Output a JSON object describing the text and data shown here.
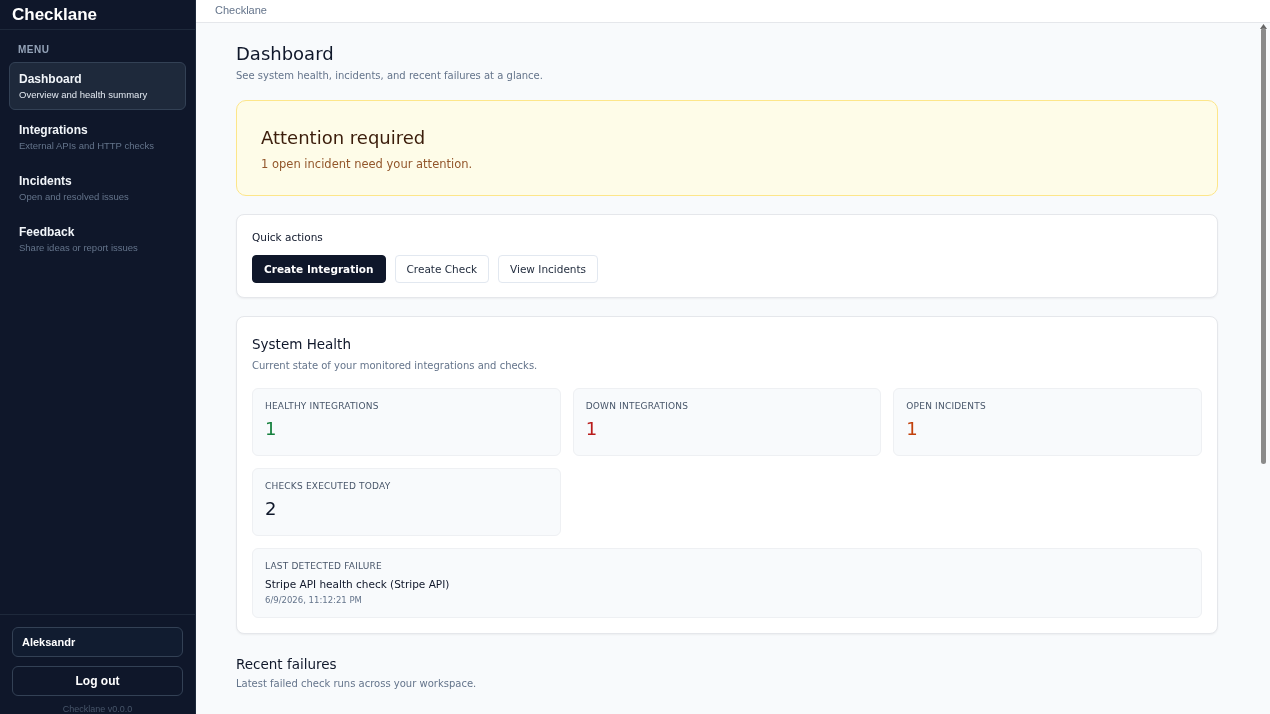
{
  "sidebar": {
    "brand": "Checklane",
    "section_label": "MENU",
    "items": [
      {
        "label": "Dashboard",
        "description": "Overview and health summary",
        "selected": true
      },
      {
        "label": "Integrations",
        "description": "External APIs and HTTP checks",
        "selected": false
      },
      {
        "label": "Incidents",
        "description": "Open and resolved issues",
        "selected": false
      },
      {
        "label": "Feedback",
        "description": "Share ideas or report issues",
        "selected": false
      }
    ],
    "user": "Aleksandr",
    "logout": "Log out",
    "version": "Checklane v0.0.0"
  },
  "topbar": {
    "breadcrumb": "Checklane"
  },
  "page": {
    "title": "Dashboard",
    "subtitle": "See system health, incidents, and recent failures at a glance."
  },
  "alert": {
    "title": "Attention required",
    "message": "1 open incident need your attention."
  },
  "quick_actions": {
    "title": "Quick actions",
    "buttons": [
      {
        "label": "Create Integration",
        "kind": "primary"
      },
      {
        "label": "Create Check",
        "kind": "secondary"
      },
      {
        "label": "View Incidents",
        "kind": "secondary"
      }
    ]
  },
  "system_health": {
    "title": "System Health",
    "subtitle": "Current state of your monitored integrations and checks.",
    "metrics": [
      {
        "label": "HEALTHY INTEGRATIONS",
        "value": "1",
        "color": "#15803d"
      },
      {
        "label": "DOWN INTEGRATIONS",
        "value": "1",
        "color": "#b91c1c"
      },
      {
        "label": "OPEN INCIDENTS",
        "value": "1",
        "color": "#c2410c"
      },
      {
        "label": "CHECKS EXECUTED TODAY",
        "value": "2",
        "color": "#0f172a"
      }
    ],
    "last_failure": {
      "label": "LAST DETECTED FAILURE",
      "name": "Stripe API health check (Stripe API)",
      "time": "6/9/2026, 11:12:21 PM"
    }
  },
  "recent_failures": {
    "title": "Recent failures",
    "subtitle": "Latest failed check runs across your workspace."
  }
}
